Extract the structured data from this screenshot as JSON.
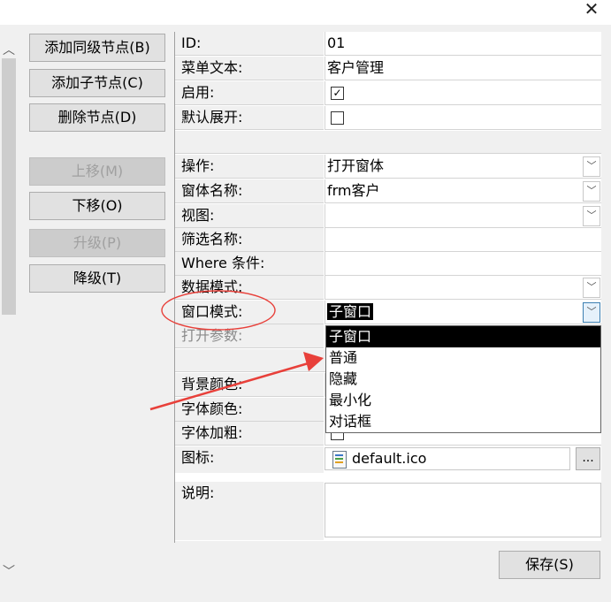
{
  "window": {
    "close_glyph": "✕"
  },
  "scrollbar": {
    "up_glyph": "︿",
    "down_glyph": "﹀"
  },
  "buttons": {
    "add_sibling": "添加同级节点(B)",
    "add_child": "添加子节点(C)",
    "delete": "删除节点(D)",
    "move_up": "上移(M)",
    "move_down": "下移(O)",
    "promote": "升级(P)",
    "demote": "降级(T)",
    "save": "保存(S)",
    "browse": "..."
  },
  "props": {
    "id": {
      "label": "ID:",
      "value": "01"
    },
    "menu_text": {
      "label": "菜单文本:",
      "value": "客户管理"
    },
    "enabled": {
      "label": "启用:",
      "checked": true,
      "check_glyph": "✓"
    },
    "default_expand": {
      "label": "默认展开:",
      "checked": false
    },
    "operation": {
      "label": "操作:",
      "value": "打开窗体"
    },
    "form_name": {
      "label": "窗体名称:",
      "value": "frm客户"
    },
    "view": {
      "label": "视图:",
      "value": ""
    },
    "filter_name": {
      "label": "筛选名称:",
      "value": ""
    },
    "where": {
      "label": "Where 条件:",
      "value": ""
    },
    "data_mode": {
      "label": "数据模式:",
      "value": ""
    },
    "window_mode": {
      "label": "窗口模式:",
      "value": "子窗口"
    },
    "open_args": {
      "label": "打开参数:",
      "value": ""
    },
    "bg_color": {
      "label": "背景颜色:"
    },
    "font_color": {
      "label": "字体颜色:"
    },
    "font_bold": {
      "label": "字体加粗:"
    },
    "icon": {
      "label": "图标:",
      "value": "default.ico"
    },
    "description": {
      "label": "说明:",
      "value": ""
    }
  },
  "window_mode_options": [
    "子窗口",
    "普通",
    "隐藏",
    "最小化",
    "对话框"
  ],
  "icons": {
    "dropdown": "chevron-down-icon",
    "file": "file-icon"
  },
  "colors": {
    "annotation": "#e8403a",
    "selection_bg": "#000000"
  }
}
